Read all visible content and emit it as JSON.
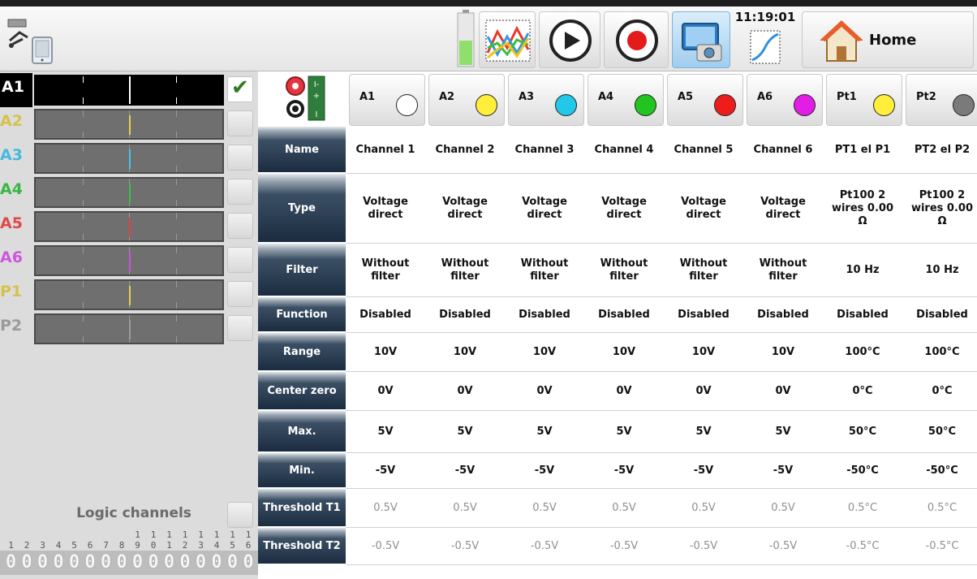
{
  "topbar": {
    "clock": "11:19:01",
    "home_label": "Home",
    "icons": {
      "system": "usb-disk-icon",
      "battery": "battery-icon",
      "chart": "chart-icon",
      "play": "play-icon",
      "record": "record-icon",
      "camera": "camera-icon",
      "trend": "trend-icon",
      "home": "home-icon"
    }
  },
  "channels": [
    {
      "label": "A1",
      "color": "#ffffff",
      "label_color": "#ffffff",
      "active": true,
      "checked": true
    },
    {
      "label": "A2",
      "color": "#e8d04a",
      "label_color": "#d6c24a",
      "active": false,
      "checked": false
    },
    {
      "label": "A3",
      "color": "#46c6e6",
      "label_color": "#46b9e0",
      "active": false,
      "checked": false
    },
    {
      "label": "A4",
      "color": "#35c24a",
      "label_color": "#36b744",
      "active": false,
      "checked": false
    },
    {
      "label": "A5",
      "color": "#e14141",
      "label_color": "#e04a4a",
      "active": false,
      "checked": false
    },
    {
      "label": "A6",
      "color": "#d150e3",
      "label_color": "#cc57db",
      "active": false,
      "checked": false
    },
    {
      "label": "P1",
      "color": "#e8d04a",
      "label_color": "#d6c24a",
      "active": false,
      "checked": false
    },
    {
      "label": "P2",
      "color": "#9a9a9a",
      "label_color": "#9a9a9a",
      "active": false,
      "checked": false
    }
  ],
  "logic": {
    "label": "Logic channels",
    "tens": [
      "",
      "",
      "",
      "",
      "",
      "",
      "",
      "",
      "1",
      "1",
      "1",
      "1",
      "1",
      "1",
      "1",
      "1"
    ],
    "units": [
      "1",
      "2",
      "3",
      "4",
      "5",
      "6",
      "7",
      "8",
      "9",
      "0",
      "1",
      "2",
      "3",
      "4",
      "5",
      "6"
    ],
    "values": [
      "0",
      "0",
      "0",
      "0",
      "0",
      "0",
      "0",
      "0",
      "0",
      "0",
      "0",
      "0",
      "0",
      "0",
      "0",
      "0"
    ]
  },
  "columns": [
    {
      "label": "A1",
      "color": "#ffffff"
    },
    {
      "label": "A2",
      "color": "#ffef3a"
    },
    {
      "label": "A3",
      "color": "#21c8e8"
    },
    {
      "label": "A4",
      "color": "#22c41f"
    },
    {
      "label": "A5",
      "color": "#ef1c1c"
    },
    {
      "label": "A6",
      "color": "#e21de6"
    },
    {
      "label": "Pt1",
      "color": "#ffef3a"
    },
    {
      "label": "Pt2",
      "color": "#7a7a7a"
    }
  ],
  "rows": [
    {
      "label": "Name",
      "cells": [
        "Channel 1",
        "Channel 2",
        "Channel 3",
        "Channel 4",
        "Channel 5",
        "Channel 6",
        "PT1  el P1",
        "PT2  el P2"
      ],
      "muted": false
    },
    {
      "label": "Type",
      "cells": [
        "Voltage direct",
        "Voltage direct",
        "Voltage direct",
        "Voltage direct",
        "Voltage direct",
        "Voltage direct",
        "Pt100 2 wires 0.00 Ω",
        "Pt100 2 wires 0.00 Ω"
      ],
      "muted": false
    },
    {
      "label": "Filter",
      "cells": [
        "Without filter",
        "Without filter",
        "Without filter",
        "Without filter",
        "Without filter",
        "Without filter",
        "10 Hz",
        "10 Hz"
      ],
      "muted": false
    },
    {
      "label": "Function",
      "cells": [
        "Disabled",
        "Disabled",
        "Disabled",
        "Disabled",
        "Disabled",
        "Disabled",
        "Disabled",
        "Disabled"
      ],
      "muted": false
    },
    {
      "label": "Range",
      "cells": [
        "10V",
        "10V",
        "10V",
        "10V",
        "10V",
        "10V",
        "100°C",
        "100°C"
      ],
      "muted": false
    },
    {
      "label": "Center zero",
      "cells": [
        "0V",
        "0V",
        "0V",
        "0V",
        "0V",
        "0V",
        "0°C",
        "0°C"
      ],
      "muted": false
    },
    {
      "label": "Max.",
      "cells": [
        "5V",
        "5V",
        "5V",
        "5V",
        "5V",
        "5V",
        "50°C",
        "50°C"
      ],
      "muted": false
    },
    {
      "label": "Min.",
      "cells": [
        "-5V",
        "-5V",
        "-5V",
        "-5V",
        "-5V",
        "-5V",
        "-50°C",
        "-50°C"
      ],
      "muted": false
    },
    {
      "label": "Threshold T1",
      "cells": [
        "0.5V",
        "0.5V",
        "0.5V",
        "0.5V",
        "0.5V",
        "0.5V",
        "0.5°C",
        "0.5°C"
      ],
      "muted": true
    },
    {
      "label": "Threshold T2",
      "cells": [
        "-0.5V",
        "-0.5V",
        "-0.5V",
        "-0.5V",
        "-0.5V",
        "-0.5V",
        "-0.5°C",
        "-0.5°C"
      ],
      "muted": true
    }
  ]
}
